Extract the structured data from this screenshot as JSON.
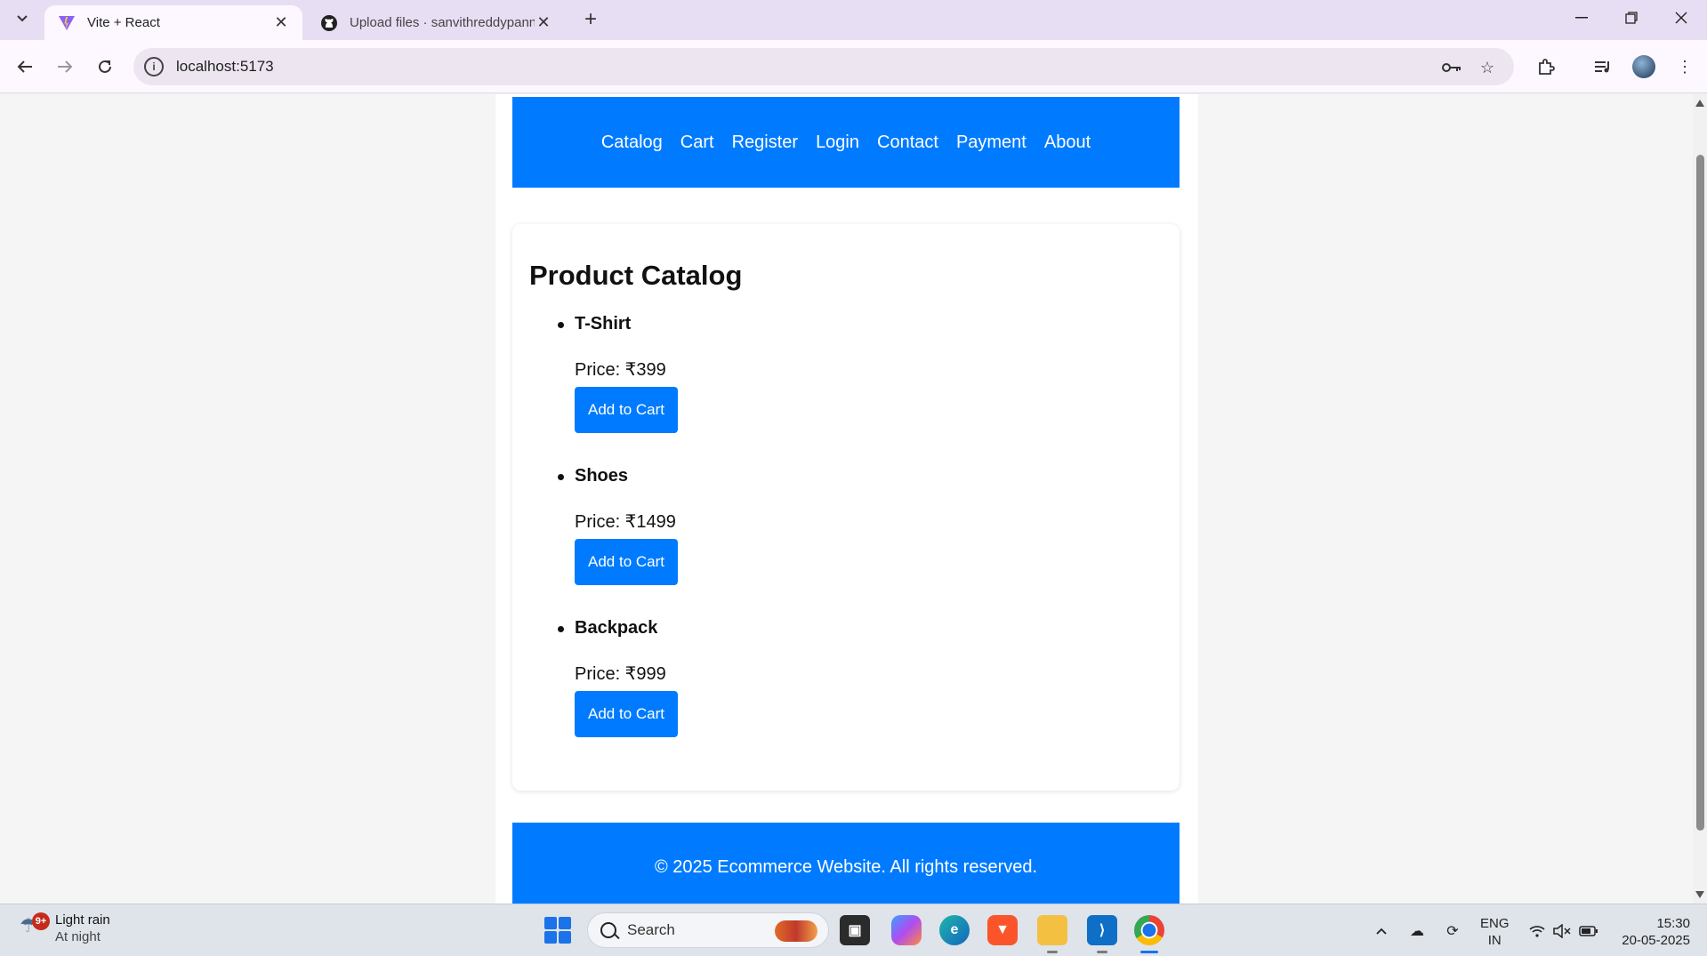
{
  "browser": {
    "tabs": [
      {
        "title": "Vite + React",
        "active": true
      },
      {
        "title": "Upload files · sanvithreddypann",
        "active": false
      }
    ],
    "url": "localhost:5173"
  },
  "site": {
    "nav": [
      "Catalog",
      "Cart",
      "Register",
      "Login",
      "Contact",
      "Payment",
      "About"
    ],
    "catalog_title": "Product Catalog",
    "products": [
      {
        "name": "T-Shirt",
        "price": "Price: ₹399",
        "button": "Add to Cart"
      },
      {
        "name": "Shoes",
        "price": "Price: ₹1499",
        "button": "Add to Cart"
      },
      {
        "name": "Backpack",
        "price": "Price: ₹999",
        "button": "Add to Cart"
      }
    ],
    "footer": "© 2025 Ecommerce Website. All rights reserved.",
    "accent": "#007bff"
  },
  "taskbar": {
    "weather_badge": "9+",
    "weather_line1": "Light rain",
    "weather_line2": "At night",
    "search_placeholder": "Search",
    "lang_line1": "ENG",
    "lang_line2": "IN",
    "time": "15:30",
    "date": "20-05-2025"
  }
}
